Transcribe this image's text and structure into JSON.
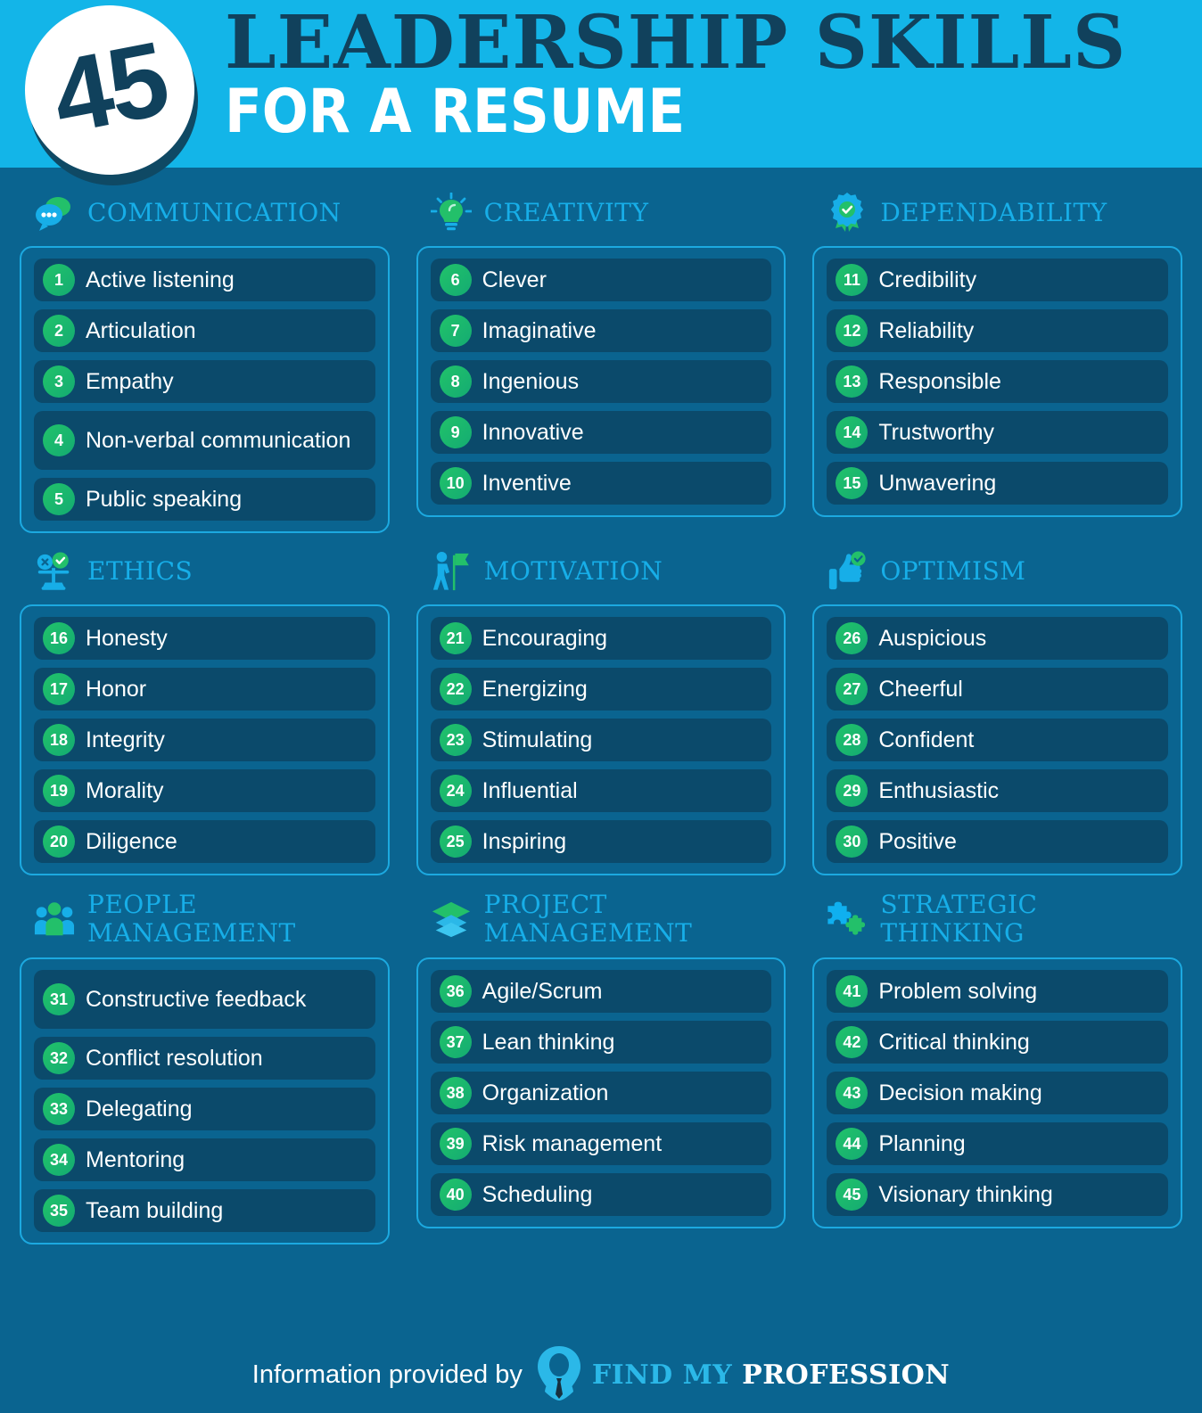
{
  "header": {
    "badge_number": "45",
    "title_main": "LEADERSHIP SKILLS",
    "title_sub": "FOR A RESUME",
    "bg_color": "#13B5E8",
    "title_color": "#11415C"
  },
  "theme": {
    "page_bg": "#0a6490",
    "item_bg": "#0B4A6B",
    "accent_cyan": "#17AEE8",
    "accent_green": "#19B368",
    "border_cyan": "#1CA9E0",
    "text_white": "#FFFFFF"
  },
  "sections": [
    {
      "title": "COMMUNICATION",
      "icon": "speech-bubbles-icon",
      "items": [
        {
          "num": "1",
          "label": "Active listening"
        },
        {
          "num": "2",
          "label": "Articulation"
        },
        {
          "num": "3",
          "label": "Empathy"
        },
        {
          "num": "4",
          "label": "Non-verbal communication"
        },
        {
          "num": "5",
          "label": "Public speaking"
        }
      ]
    },
    {
      "title": "CREATIVITY",
      "icon": "lightbulb-icon",
      "items": [
        {
          "num": "6",
          "label": "Clever"
        },
        {
          "num": "7",
          "label": "Imaginative"
        },
        {
          "num": "8",
          "label": "Ingenious"
        },
        {
          "num": "9",
          "label": "Innovative"
        },
        {
          "num": "10",
          "label": "Inventive"
        }
      ]
    },
    {
      "title": "DEPENDABILITY",
      "icon": "award-ribbon-icon",
      "items": [
        {
          "num": "11",
          "label": "Credibility"
        },
        {
          "num": "12",
          "label": "Reliability"
        },
        {
          "num": "13",
          "label": "Responsible"
        },
        {
          "num": "14",
          "label": "Trustworthy"
        },
        {
          "num": "15",
          "label": "Unwavering"
        }
      ]
    },
    {
      "title": "ETHICS",
      "icon": "balance-scale-icon",
      "items": [
        {
          "num": "16",
          "label": "Honesty"
        },
        {
          "num": "17",
          "label": "Honor"
        },
        {
          "num": "18",
          "label": "Integrity"
        },
        {
          "num": "19",
          "label": "Morality"
        },
        {
          "num": "20",
          "label": "Diligence"
        }
      ]
    },
    {
      "title": "MOTIVATION",
      "icon": "person-with-flag-icon",
      "items": [
        {
          "num": "21",
          "label": "Encouraging"
        },
        {
          "num": "22",
          "label": "Energizing"
        },
        {
          "num": "23",
          "label": "Stimulating"
        },
        {
          "num": "24",
          "label": "Influential"
        },
        {
          "num": "25",
          "label": "Inspiring"
        }
      ]
    },
    {
      "title": "OPTIMISM",
      "icon": "thumbs-up-icon",
      "items": [
        {
          "num": "26",
          "label": "Auspicious"
        },
        {
          "num": "27",
          "label": "Cheerful"
        },
        {
          "num": "28",
          "label": "Confident"
        },
        {
          "num": "29",
          "label": "Enthusiastic"
        },
        {
          "num": "30",
          "label": "Positive"
        }
      ]
    },
    {
      "title": "PEOPLE MANAGEMENT",
      "icon": "people-group-icon",
      "items": [
        {
          "num": "31",
          "label": "Constructive feedback"
        },
        {
          "num": "32",
          "label": "Conflict resolution"
        },
        {
          "num": "33",
          "label": "Delegating"
        },
        {
          "num": "34",
          "label": "Mentoring"
        },
        {
          "num": "35",
          "label": "Team building"
        }
      ]
    },
    {
      "title": "PROJECT MANAGEMENT",
      "icon": "layers-stack-icon",
      "items": [
        {
          "num": "36",
          "label": "Agile/Scrum"
        },
        {
          "num": "37",
          "label": "Lean thinking"
        },
        {
          "num": "38",
          "label": "Organization"
        },
        {
          "num": "39",
          "label": "Risk management"
        },
        {
          "num": "40",
          "label": "Scheduling"
        }
      ]
    },
    {
      "title": "STRATEGIC THINKING",
      "icon": "puzzle-pieces-icon",
      "items": [
        {
          "num": "41",
          "label": "Problem solving"
        },
        {
          "num": "42",
          "label": "Critical thinking"
        },
        {
          "num": "43",
          "label": "Decision making"
        },
        {
          "num": "44",
          "label": "Planning"
        },
        {
          "num": "45",
          "label": "Visionary thinking"
        }
      ]
    }
  ],
  "footer": {
    "credit_text": "Information provided by",
    "brand_first": "FIND MY ",
    "brand_second": "PROFESSION",
    "logo": "find-my-profession-pin-logo"
  }
}
